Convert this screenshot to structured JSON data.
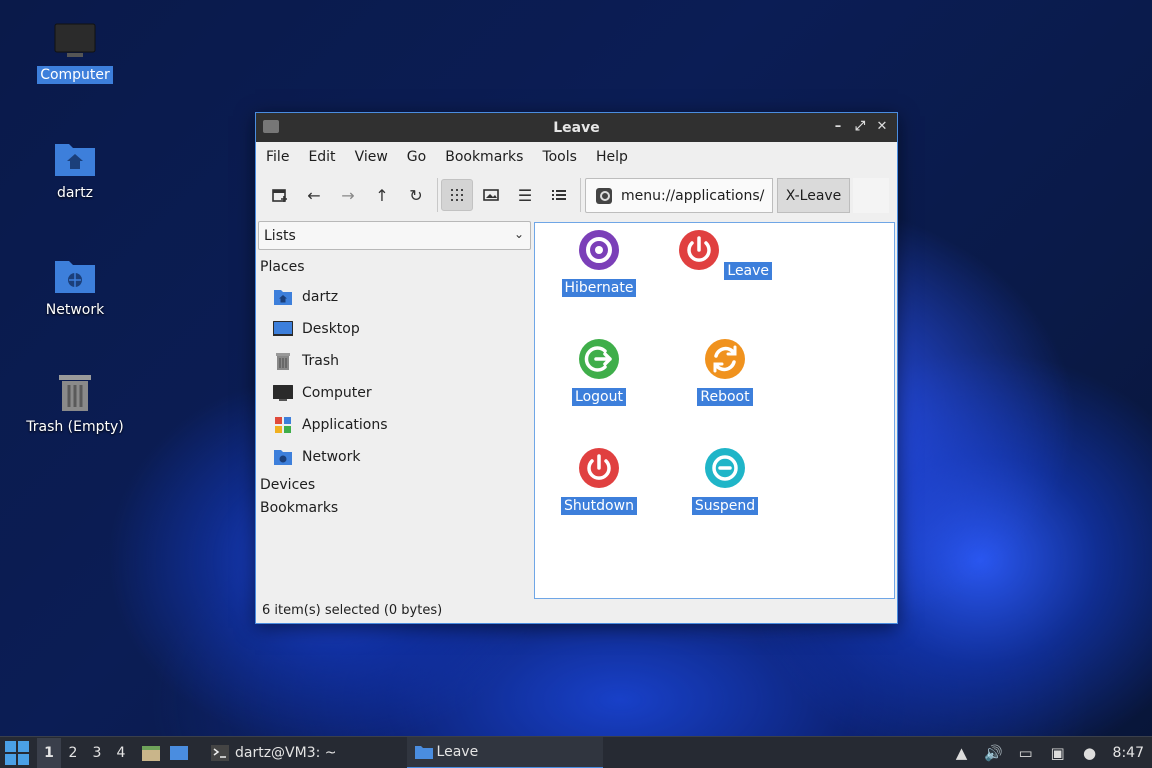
{
  "desktop": {
    "icons": [
      {
        "label": "Computer",
        "icon": "monitor-icon",
        "selected": true
      },
      {
        "label": "dartz",
        "icon": "home-folder-icon",
        "selected": false
      },
      {
        "label": "Network",
        "icon": "network-folder-icon",
        "selected": false
      },
      {
        "label": "Trash (Empty)",
        "icon": "trash-icon",
        "selected": false
      }
    ]
  },
  "window": {
    "title": "Leave",
    "controls": {
      "minimize": "–",
      "maximize": "⤢",
      "close": "✕"
    },
    "menu": [
      "File",
      "Edit",
      "View",
      "Go",
      "Bookmarks",
      "Tools",
      "Help"
    ],
    "toolbar": {
      "path": "menu://applications/",
      "breadcrumb": "X-Leave"
    },
    "sidebar": {
      "mode": "Lists",
      "places_heading": "Places",
      "places": [
        {
          "label": "dartz",
          "icon": "home-folder-icon",
          "color": "#3d7fdb"
        },
        {
          "label": "Desktop",
          "icon": "desktop-icon",
          "color": "#3d7fdb"
        },
        {
          "label": "Trash",
          "icon": "trash-icon",
          "color": "#888888"
        },
        {
          "label": "Computer",
          "icon": "monitor-icon",
          "color": "#2a2a2a"
        },
        {
          "label": "Applications",
          "icon": "applications-icon",
          "color": "#e04a3a"
        },
        {
          "label": "Network",
          "icon": "network-folder-icon",
          "color": "#3d7fdb"
        }
      ],
      "devices_heading": "Devices",
      "bookmarks_heading": "Bookmarks"
    },
    "items": [
      {
        "label": "Hibernate",
        "icon": "hibernate-icon",
        "color": "#7b3fb8"
      },
      {
        "label": "Leave",
        "icon": "power-icon",
        "color": "#e04040"
      },
      {
        "label": "Logout",
        "icon": "logout-icon",
        "color": "#3fae4a"
      },
      {
        "label": "Reboot",
        "icon": "reboot-icon",
        "color": "#f0921e"
      },
      {
        "label": "Shutdown",
        "icon": "shutdown-icon",
        "color": "#e04040"
      },
      {
        "label": "Suspend",
        "icon": "suspend-icon",
        "color": "#1fb5c8"
      }
    ],
    "status": "6 item(s) selected (0 bytes)"
  },
  "taskbar": {
    "workspaces": [
      "1",
      "2",
      "3",
      "4"
    ],
    "active_workspace": "1",
    "tasks": [
      {
        "label": "dartz@VM3: ~",
        "icon": "terminal-icon"
      },
      {
        "label": "Leave",
        "icon": "folder-icon"
      }
    ],
    "clock": "8:47"
  }
}
